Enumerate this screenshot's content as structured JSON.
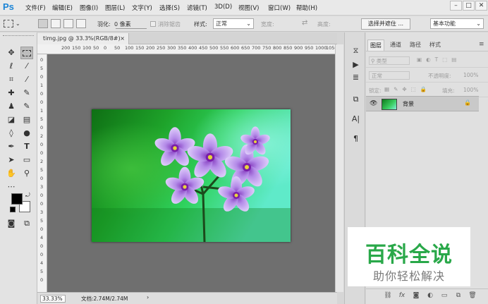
{
  "app": {
    "logo": "Ps"
  },
  "menu": [
    "文件(F)",
    "编辑(E)",
    "图像(I)",
    "图层(L)",
    "文字(Y)",
    "选择(S)",
    "滤镜(T)",
    "3D(D)",
    "视图(V)",
    "窗口(W)",
    "帮助(H)"
  ],
  "window_controls": {
    "minimize": "–",
    "maximize": "□",
    "close": "✕"
  },
  "options": {
    "feather_label": "羽化:",
    "feather_value": "0 像素",
    "antialias_label": "消除锯齿",
    "style_label": "样式:",
    "style_value": "正常",
    "width_label": "宽度:",
    "height_label": "高度:",
    "select_mask_button": "选择并遮住 ...",
    "workspace_value": "基本功能"
  },
  "document": {
    "tab_title": "timg.jpg @ 33.3%(RGB/8#)",
    "tab_close": "×",
    "zoom": "33.33%",
    "doc_info": "文档:2.74M/2.74M",
    "ruler_top": [
      "200",
      "150",
      "100",
      "50",
      "0",
      "50",
      "100",
      "150",
      "200",
      "250",
      "300",
      "350",
      "400",
      "450",
      "500",
      "550",
      "600",
      "650",
      "700",
      "750",
      "800",
      "850",
      "900",
      "950",
      "1000",
      "1050",
      "1100",
      "1150"
    ],
    "ruler_left": [
      "0",
      "5",
      "0",
      "1",
      "0",
      "0",
      "1",
      "5",
      "0",
      "2",
      "0",
      "0",
      "2",
      "5",
      "0",
      "3",
      "0",
      "0",
      "3",
      "5",
      "0",
      "4",
      "0",
      "0",
      "4",
      "5",
      "0"
    ]
  },
  "layers_panel": {
    "tabs": [
      "图层",
      "通道",
      "路径",
      "样式"
    ],
    "filter_kind": "类型",
    "blend_mode": "正常",
    "opacity_label": "不透明度:",
    "opacity_value": "100%",
    "lock_label": "锁定:",
    "fill_label": "填充:",
    "fill_value": "100%",
    "layer_name": "背景"
  },
  "watermark": {
    "title": "百科全说",
    "subtitle": "助你轻松解决"
  },
  "colors": {
    "accent_green": "#29a849",
    "ps_blue": "#1b84d6",
    "canvas_bg": "#6f6f6f"
  }
}
